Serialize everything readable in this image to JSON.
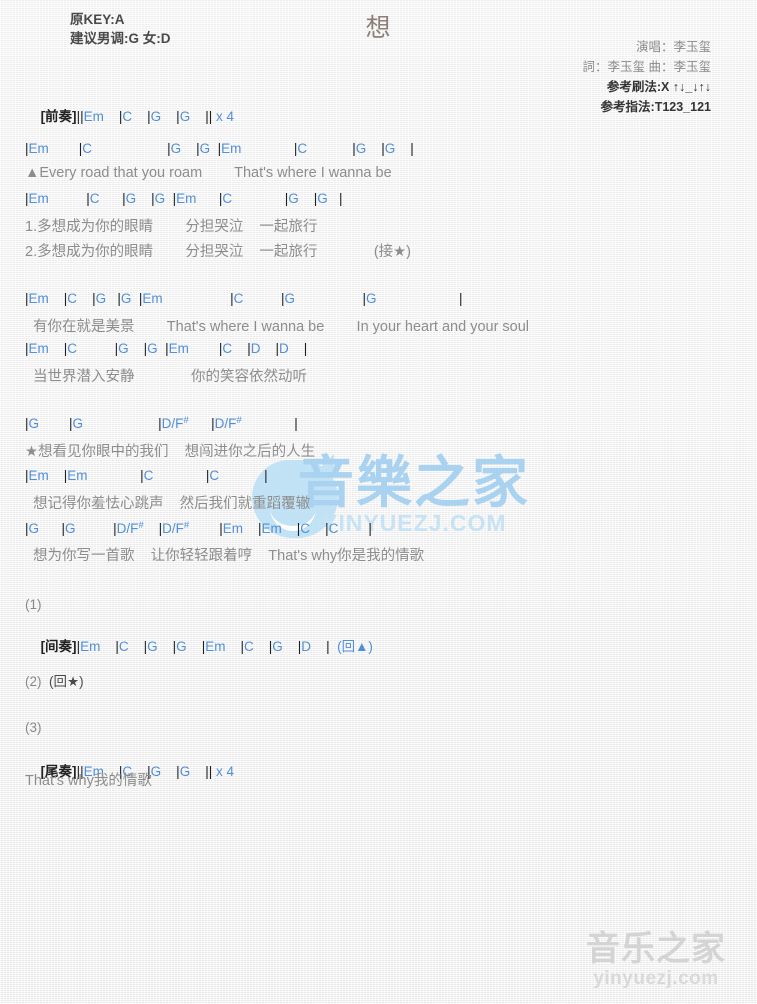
{
  "header": {
    "title": "想",
    "key_line": "原KEY:A",
    "suggest_line": "建议男调:G 女:D",
    "singer": "演唱：李玉玺",
    "writer": "詞：李玉玺  曲：李玉玺",
    "strum": "参考刷法:X ↑↓_↓↑↓",
    "fingering": "参考指法:T123_121"
  },
  "intro": {
    "tag": "[前奏]",
    "chords": "||Em    |C    |G    |G    || x 4"
  },
  "verse1": {
    "chord_line_1": "|Em        |C                    |G    |G  |Em              |C            |G    |G    |",
    "lyric_line_1": "▲Every road that you roam        That's where I wanna be",
    "chord_line_2": "|Em          |C      |G    |G  |Em      |C              |G    |G   |",
    "lyric_line_2": "1.多想成为你的眼睛        分担哭泣    一起旅行",
    "lyric_line_3": "2.多想成为你的眼睛        分担哭泣    一起旅行              (接★)"
  },
  "verse2": {
    "chord_line_1": "|Em    |C    |G   |G  |Em                  |C          |G                  |G                      |",
    "lyric_line_1": "  有你在就是美景        That's where I wanna be        In your heart and your soul",
    "chord_line_2": "|Em    |C          |G    |G  |Em        |C    |D    |D    |",
    "lyric_line_2": "  当世界潜入安静              你的笑容依然动听"
  },
  "chorus": {
    "chord_line_1": "|G        |G                    |D/F#      |D/F#              |",
    "lyric_line_1": "★想看见你眼中的我们    想闯进你之后的人生",
    "chord_line_2": "|Em    |Em              |C              |C            |",
    "lyric_line_2": "  想记得你羞怯心跳声    然后我们就重蹈覆辙",
    "chord_line_3": "|G      |G          |D/F#    |D/F#        |Em    |Em    |C    |C        |",
    "lyric_line_3": "  想为你写一首歌    让你轻轻跟着哼    That's why你是我的情歌"
  },
  "sections": {
    "num_1": "(1)",
    "interlude_tag": "[间奏]",
    "interlude_chords": "|Em    |C    |G    |G    |Em    |C    |G    |D    |  (回▲)",
    "num_2": "(2)",
    "repeat_star": "(回★)",
    "num_3": "(3)",
    "outro_tag": "[尾奏]",
    "outro_chords": "||Em    |C    |G    |G    || x 4",
    "outro_lyric": "That's why我的情歌"
  },
  "watermark_center": {
    "cn": "音樂之家",
    "en": "YINYUEZJ.COM"
  },
  "watermark_bottom": {
    "cn": "音乐之家",
    "en": "yinyuezj.com"
  },
  "colors": {
    "chord": "#4f8fd6",
    "lyric": "#8d8d8d",
    "section_tag": "#222222",
    "title": "#8d7f77",
    "watermark_blue": "#9ccdf0",
    "watermark_gray": "#d4d4d4"
  }
}
